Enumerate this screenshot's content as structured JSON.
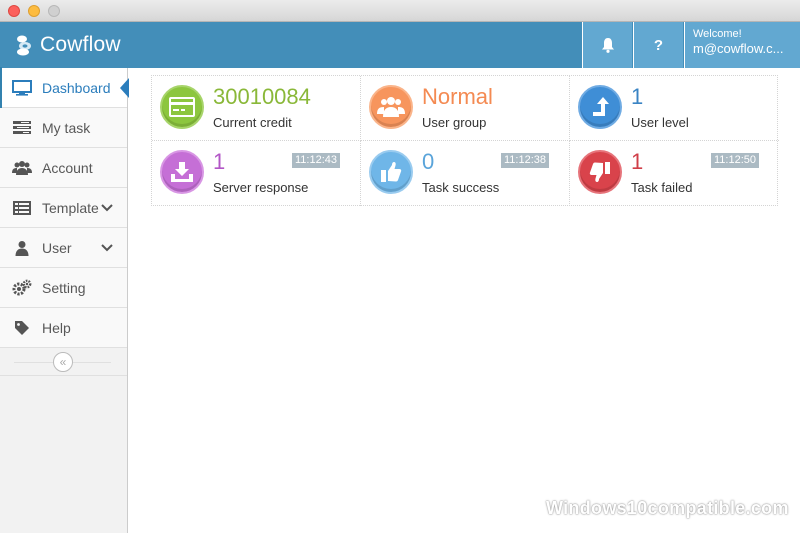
{
  "app": {
    "name": "Cowflow"
  },
  "header": {
    "welcome": "Welcome!",
    "email": "m@cowflow.c...",
    "help_label": "?"
  },
  "sidebar": {
    "items": [
      {
        "label": "Dashboard",
        "icon": "monitor-icon",
        "active": true
      },
      {
        "label": "My task",
        "icon": "tasks-icon"
      },
      {
        "label": "Account",
        "icon": "users-icon"
      },
      {
        "label": "Template",
        "icon": "list-icon",
        "expandable": true
      },
      {
        "label": "User",
        "icon": "user-icon",
        "expandable": true
      },
      {
        "label": "Setting",
        "icon": "gears-icon"
      },
      {
        "label": "Help",
        "icon": "tag-icon"
      }
    ],
    "collapse_glyph": "«"
  },
  "stats": [
    {
      "value": "30010084",
      "label": "Current credit",
      "color": "#8ab839",
      "icon": "credit-card-icon"
    },
    {
      "value": "Normal",
      "label": "User group",
      "color": "#f48a52",
      "icon": "group-icon"
    },
    {
      "value": "1",
      "label": "User level",
      "color": "#3a84c4",
      "icon": "level-up-icon"
    },
    {
      "value": "1",
      "label": "Server response",
      "color": "#b256c6",
      "icon": "download-icon",
      "time": "11:12:43"
    },
    {
      "value": "0",
      "label": "Task success",
      "color": "#5aa4da",
      "icon": "thumbs-up-icon",
      "time": "11:12:38"
    },
    {
      "value": "1",
      "label": "Task failed",
      "color": "#d03e48",
      "icon": "thumbs-down-icon",
      "time": "11:12:50"
    }
  ],
  "watermark": "Windows10compatible.com"
}
